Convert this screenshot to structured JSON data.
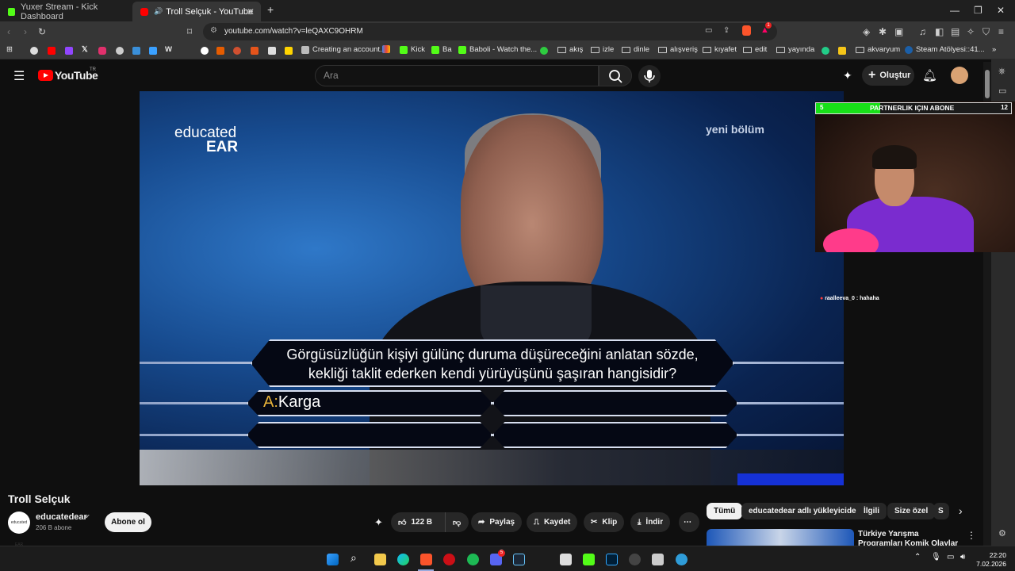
{
  "browser": {
    "tabs": [
      {
        "label": "Yuxer Stream - Kick Dashboard",
        "icon": "kick-icon",
        "active": false
      },
      {
        "label": "Troll Selçuk - YouTube",
        "icon": "youtube-icon",
        "active": true
      }
    ],
    "new_tab_label": "+",
    "url": "youtube.com/watch?v=leQAXC9OHRM",
    "extension_badge": "1",
    "bookmarks": [
      {
        "label": "Creating an account...",
        "type": "link"
      },
      {
        "label": "Kick",
        "type": "link"
      },
      {
        "label": "Ba",
        "type": "link"
      },
      {
        "label": "Baboli - Watch the...",
        "type": "link"
      },
      {
        "label": "akış",
        "type": "folder"
      },
      {
        "label": "izle",
        "type": "folder"
      },
      {
        "label": "dinle",
        "type": "folder"
      },
      {
        "label": "alışveriş",
        "type": "folder"
      },
      {
        "label": "kıyafet",
        "type": "folder"
      },
      {
        "label": "edit",
        "type": "folder"
      },
      {
        "label": "yayında",
        "type": "folder"
      },
      {
        "label": "akvaryum",
        "type": "folder"
      },
      {
        "label": "Steam Atölyesi::41...",
        "type": "link"
      }
    ]
  },
  "youtube": {
    "logo_text": "YouTube",
    "country_code": "TR",
    "search_placeholder": "Ara",
    "create_label": "Oluştur"
  },
  "video": {
    "watermark_top": "educated",
    "watermark_bottom": "EAR",
    "corner_label": "yeni bölüm",
    "question_line1": "Görgüsüzlüğün kişiyi gülünç duruma düşüreceğini anlatan sözde,",
    "question_line2": "kekliği taklit ederken kendi yürüyüşünü şaşıran hangisidir?",
    "answer_letter": "A:",
    "answer_text": "Karga"
  },
  "stream_overlay": {
    "goal_label": "PARTNERLIK IÇIN ABONE",
    "goal_current": "5",
    "goal_target": "12",
    "goal_progress": 0.33,
    "chat_message": "raalleeva_0 : hahaha"
  },
  "watch": {
    "title": "Troll Selçuk",
    "channel_name": "educatedear",
    "channel_avatar_text": "educated EAR",
    "subscribers": "206 B abone",
    "subscribe_label": "Abone ol",
    "likes": "122 B",
    "share_label": "Paylaş",
    "save_label": "Kaydet",
    "clip_label": "Klip",
    "download_label": "İndir"
  },
  "related": {
    "chips": [
      "Tümü",
      "educatedear adlı yükleyiciden",
      "İlgili",
      "Size özel",
      "S"
    ],
    "first_video_title": "Türkiye Yarışma Programları Komik Olaylar"
  },
  "taskbar": {
    "time": "22:20",
    "date": "7.02.2026",
    "discord_badge": "5"
  },
  "colors": {
    "youtube_red": "#ff0000",
    "kick_green": "#53fc18",
    "goal_green": "#18e018",
    "overlay_purple": "#7a2ccf"
  }
}
